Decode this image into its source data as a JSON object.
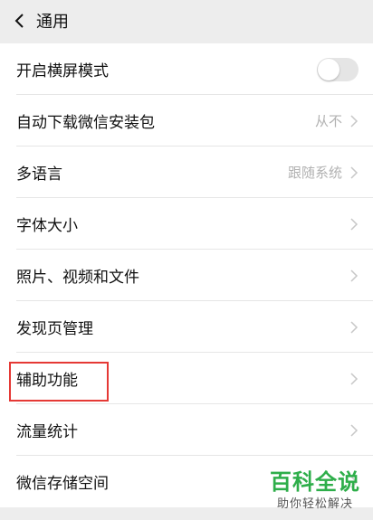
{
  "header": {
    "title": "通用"
  },
  "settings": [
    {
      "label": "开启横屏模式",
      "type": "toggle",
      "on": false
    },
    {
      "label": "自动下载微信安装包",
      "value": "从不",
      "type": "nav"
    },
    {
      "label": "多语言",
      "value": "跟随系统",
      "type": "nav"
    },
    {
      "label": "字体大小",
      "type": "nav"
    },
    {
      "label": "照片、视频和文件",
      "type": "nav"
    },
    {
      "label": "发现页管理",
      "type": "nav"
    },
    {
      "label": "辅助功能",
      "type": "nav",
      "highlighted": true
    },
    {
      "label": "流量统计",
      "type": "nav"
    },
    {
      "label": "微信存储空间",
      "type": "nav"
    }
  ],
  "watermark": {
    "main": "百科全说",
    "sub": "助你轻松解决"
  },
  "colors": {
    "highlight": "#e53935",
    "watermark": "#2eae4a"
  }
}
